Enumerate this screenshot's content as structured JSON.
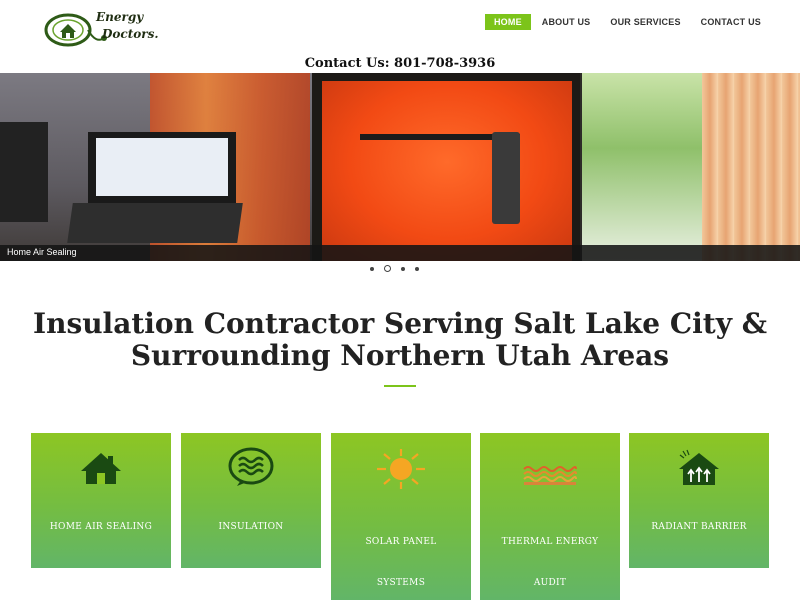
{
  "brand": {
    "line1": "Energy",
    "line2": "Doctors."
  },
  "nav": {
    "items": [
      {
        "label": "HOME",
        "active": true
      },
      {
        "label": "ABOUT US",
        "active": false
      },
      {
        "label": "OUR SERVICES",
        "active": false
      },
      {
        "label": "CONTACT US",
        "active": false
      }
    ]
  },
  "contact": {
    "text": "Contact Us: 801-708-3936"
  },
  "hero": {
    "caption": "Home Air Sealing",
    "slides_count": 4,
    "active_slide": 2
  },
  "main": {
    "heading": "Insulation Contractor Serving Salt Lake City & Surrounding Northern Utah Areas"
  },
  "services": [
    {
      "label": "HOME AIR SEALING",
      "icon": "house-icon"
    },
    {
      "label": "INSULATION",
      "icon": "insulation-waves-icon"
    },
    {
      "label": "SOLAR PANEL SYSTEMS",
      "icon": "sun-icon"
    },
    {
      "label": "THERMAL ENERGY AUDIT",
      "icon": "thermal-waves-icon"
    },
    {
      "label": "RADIANT BARRIER",
      "icon": "radiant-house-icon"
    }
  ],
  "colors": {
    "accent": "#7cc41a",
    "card_top": "#8dc623",
    "card_bottom": "#62b568",
    "sun": "#f5a623"
  }
}
